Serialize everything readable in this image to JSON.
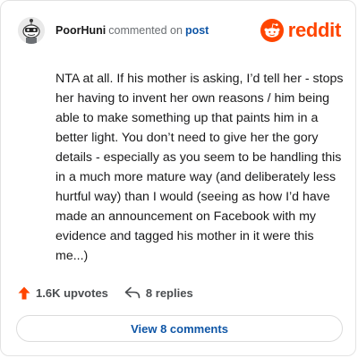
{
  "comment": {
    "username": "PoorHuni",
    "action_text": "commented on",
    "post_link": "post",
    "body": "NTA at all. If his mother is asking, I’d tell her - stops her having to invent her own reasons / him being able to make something up that paints him in a better light. You don’t need to give her the gory details - especially as you seem to be handling this in a much more mature way (and deliberately less hurtful way) than I would (seeing as how I’d have made an announcement on Facebook with my evidence and tagged his mother in it were this me...)"
  },
  "brand": {
    "name": "reddit",
    "icon": "reddit-logo-icon",
    "color": "#ff4500"
  },
  "actions": {
    "upvotes": "1.6K upvotes",
    "upvote_icon": "upvote-arrow-icon",
    "upvote_color": "#ff4500",
    "replies": "8 replies",
    "reply_icon": "reply-arrow-icon"
  },
  "view_button": {
    "label": "View 8 comments",
    "color": "#0f56a6"
  }
}
